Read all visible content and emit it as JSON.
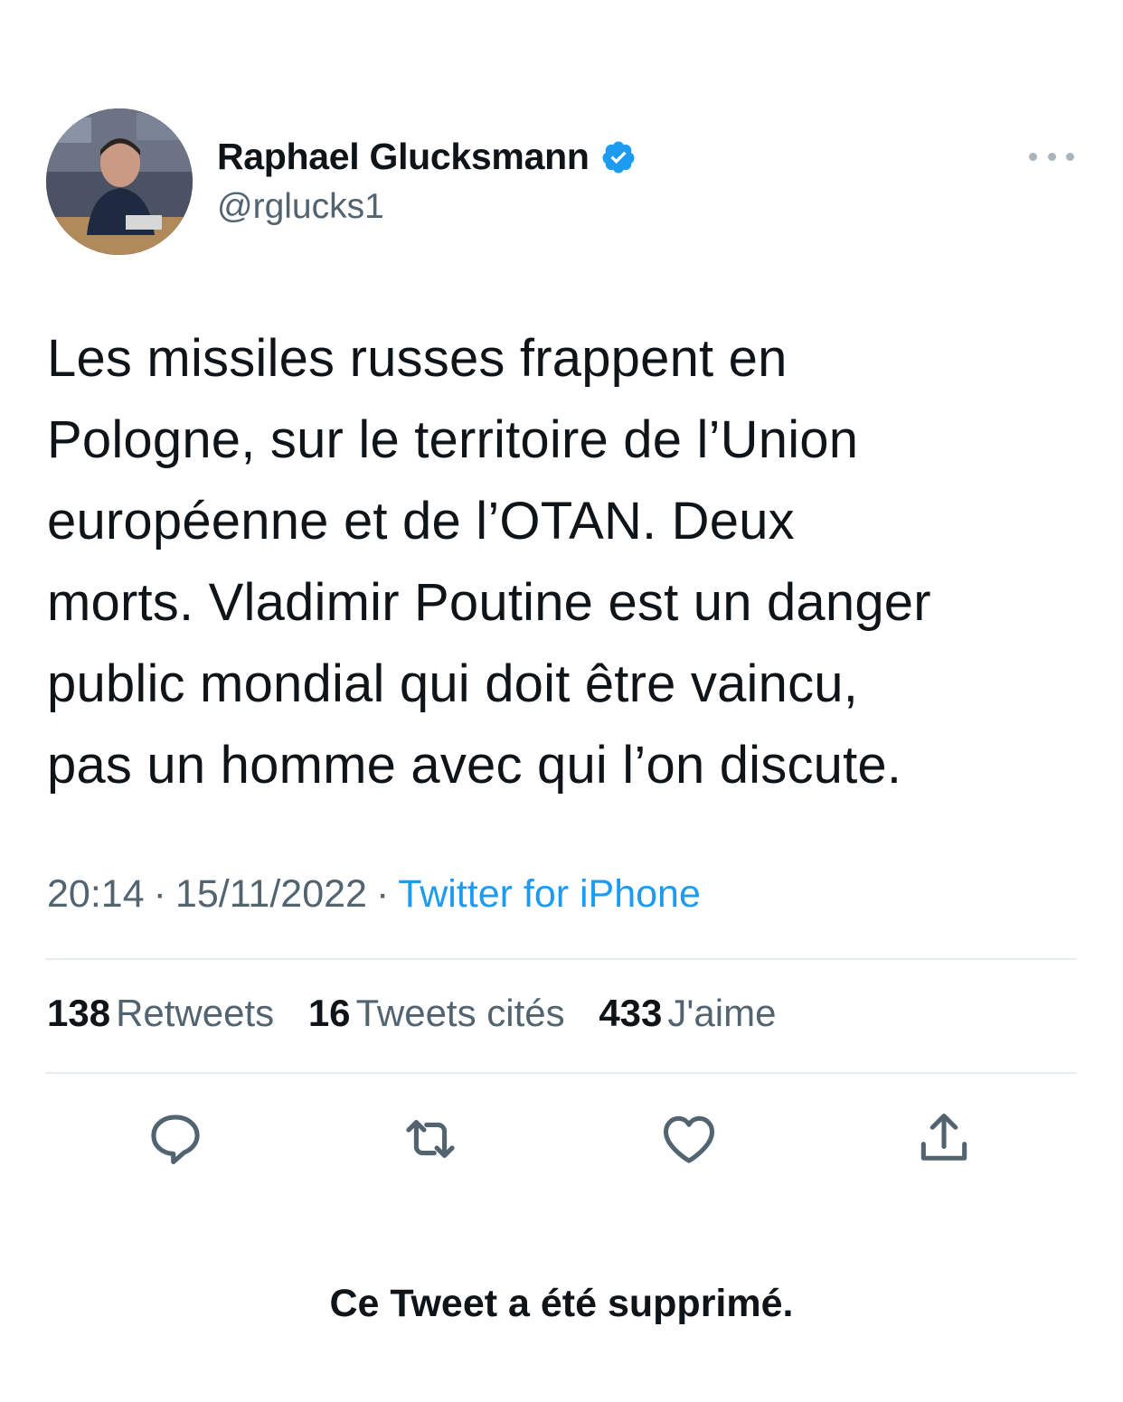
{
  "author": {
    "name": "Raphael Glucksmann",
    "handle": "@rglucks1",
    "verified": true
  },
  "tweet": {
    "lines": [
      "Les missiles russes frappent en",
      "Pologne, sur le territoire de l’Union",
      "européenne et de l’OTAN. Deux",
      "morts. Vladimir Poutine est un danger",
      "public mondial qui doit être vaincu,",
      "pas un homme avec qui l’on discute."
    ]
  },
  "meta": {
    "time": "20:14",
    "separator": "·",
    "date": "15/11/2022",
    "source": "Twitter for iPhone"
  },
  "stats": {
    "retweets_count": "138",
    "retweets_label": "Retweets",
    "quotes_count": "16",
    "quotes_label": "Tweets cités",
    "likes_count": "433",
    "likes_label": "J'aime"
  },
  "footer": {
    "deleted_notice": "Ce Tweet a été supprimé."
  },
  "icons": {
    "verified": "verified-badge-icon",
    "more": "more-horizontal-icon",
    "reply": "reply-icon",
    "retweet": "retweet-icon",
    "like": "heart-icon",
    "share": "share-icon"
  },
  "colors": {
    "text": "#0f1419",
    "secondary": "#536471",
    "link": "#1d9bf0",
    "divider": "#e6ecf0"
  }
}
